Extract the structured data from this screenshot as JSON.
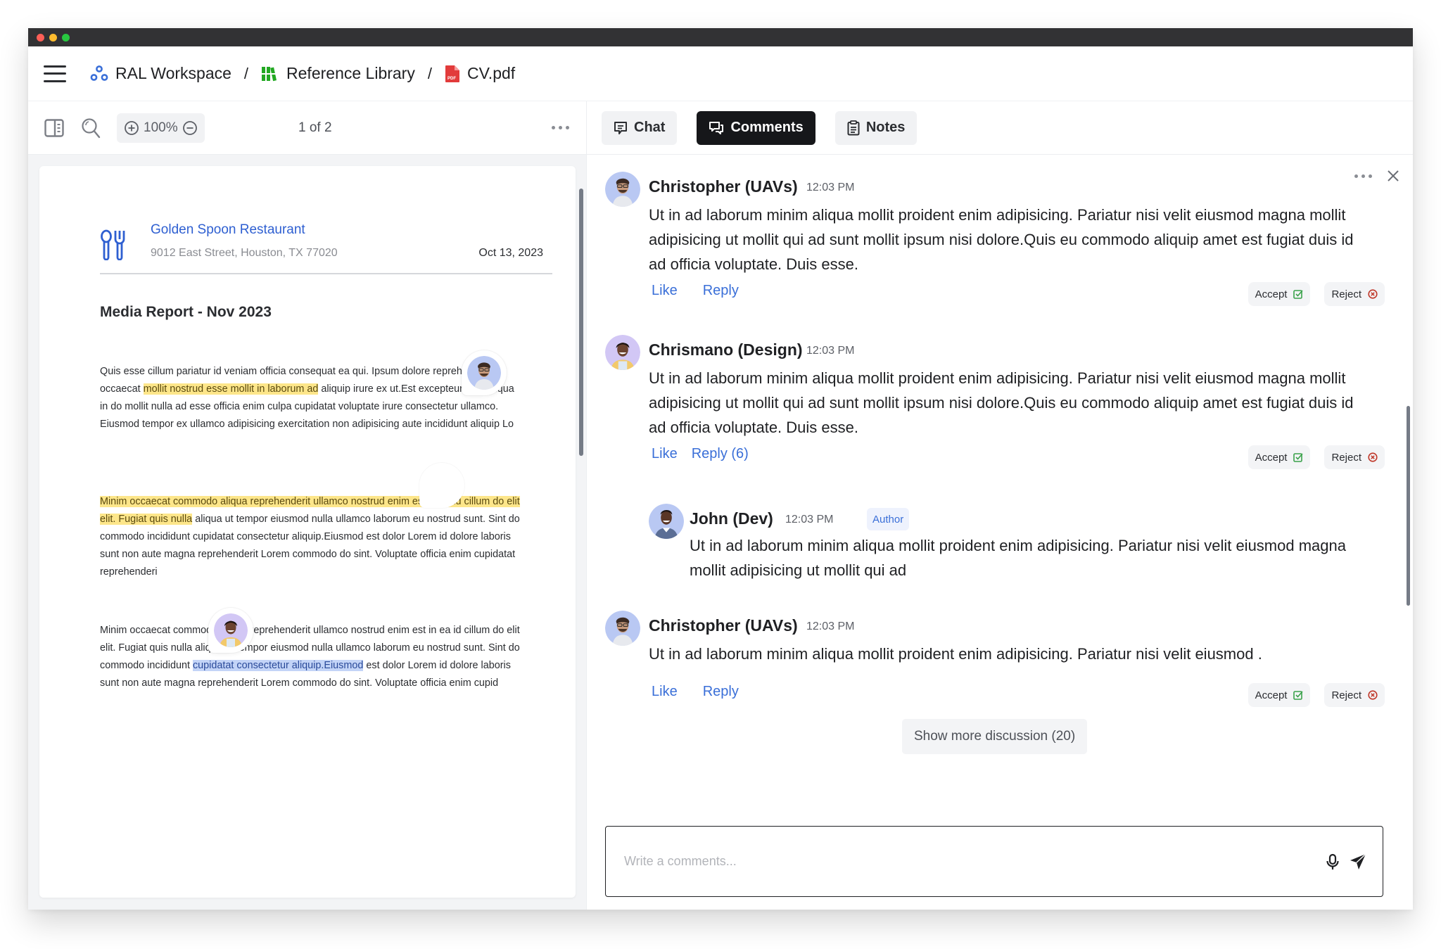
{
  "window": {
    "controls": [
      "close",
      "minimize",
      "zoom"
    ]
  },
  "breadcrumb": {
    "items": [
      {
        "label": "RAL Workspace",
        "icon": "workspace-icon"
      },
      {
        "label": "Reference Library",
        "icon": "library-icon"
      },
      {
        "label": "CV.pdf",
        "icon": "pdf-file-icon"
      }
    ],
    "separator": "/"
  },
  "viewer_toolbar": {
    "zoom_level": "100%",
    "page_indicator": "1 of 2"
  },
  "document": {
    "company": "Golden Spoon Restaurant",
    "address": "9012 East Street, Houston, TX 77020",
    "date": "Oct 13, 2023",
    "title": "Media Report - Nov 2023",
    "paragraph1": {
      "before": "Quis esse cillum pariatur id veniam officia consequat ea qui. Ipsum dolore reprehenderit occaecat ",
      "highlight": "mollit nostrud esse mollit in laborum ad",
      "after": " aliquip irure ex ut.Est excepteur duis aliqua in do mollit nulla ad esse officia enim culpa cupidatat voluptate irure consectetur ullamco. Eiusmod tempor ex ullamco adipisicing exercitation non adipisicing aute incididunt aliquip Lo"
    },
    "paragraph2": {
      "highlight": "Minim occaecat commodo aliqua reprehenderit ullamco nostrud enim est in ea id cillum do elit elit. Fugiat quis nulla",
      "after": " aliqua ut tempor eiusmod nulla ullamco laborum eu nostrud sunt. Sint do commodo incididunt cupidatat consectetur aliquip.Eiusmod est dolor Lorem id dolore laboris sunt non aute magna reprehenderit Lorem commodo do sint. Voluptate officia enim cupidatat reprehenderi"
    },
    "paragraph3": {
      "before": "Minim occaecat commodo aliqua reprehenderit ullamco nostrud enim est in ea id cillum do elit elit. Fugiat quis nulla aliqua ut tempor eiusmod nulla ullamco laborum eu nostrud sunt. Sint do commodo incididunt ",
      "highlight": "cupidatat consectetur aliquip.Eiusmod",
      "after": " est dolor Lorem id dolore laboris sunt non aute magna reprehenderit Lorem commodo do sint. Voluptate officia enim cupid"
    }
  },
  "tabs": [
    {
      "label": "Chat",
      "icon": "chat-icon",
      "active": false
    },
    {
      "label": "Comments",
      "icon": "comments-icon",
      "active": true
    },
    {
      "label": "Notes",
      "icon": "notes-icon",
      "active": false
    }
  ],
  "comments": [
    {
      "author": "Christopher (UAVs)",
      "time": "12:03 PM",
      "body": "Ut in ad laborum minim aliqua mollit proident enim adipisicing. Pariatur nisi velit eiusmod magna mollit adipisicing ut mollit qui ad sunt mollit ipsum nisi dolore.Quis eu commodo aliquip amet est fugiat duis id ad officia voluptate. Duis esse.",
      "like_label": "Like",
      "reply_label": "Reply",
      "accept_label": "Accept",
      "reject_label": "Reject"
    },
    {
      "author": "Chrismano (Design)",
      "time": "12:03 PM",
      "body": "Ut in ad laborum minim aliqua mollit proident enim adipisicing. Pariatur nisi velit eiusmod magna mollit adipisicing ut mollit qui ad sunt mollit ipsum nisi dolore.Quis eu commodo aliquip amet est fugiat duis id ad officia voluptate. Duis esse.",
      "like_label": "Like",
      "reply_label": "Reply (6)",
      "accept_label": "Accept",
      "reject_label": "Reject",
      "replies": [
        {
          "author": "John (Dev)",
          "time": "12:03 PM",
          "badge": "Author",
          "body": "Ut in ad laborum minim aliqua mollit proident enim adipisicing. Pariatur nisi velit eiusmod magna mollit adipisicing ut mollit qui ad"
        }
      ]
    },
    {
      "author": "Christopher (UAVs)",
      "time": "12:03 PM",
      "body": "Ut in ad laborum minim aliqua mollit proident enim adipisicing. Pariatur nisi velit eiusmod .",
      "like_label": "Like",
      "reply_label": "Reply",
      "accept_label": "Accept",
      "reject_label": "Reject"
    }
  ],
  "show_more_label": "Show more discussion (20)",
  "composer": {
    "placeholder": "Write a comments...",
    "value": ""
  },
  "colors": {
    "accent_blue": "#3a6fd8",
    "highlight_yellow": "#fde68a",
    "highlight_blue": "#c3d4f7",
    "active_tab": "#16171a",
    "accept_green": "#3aa14a",
    "reject_red": "#c0392b",
    "pdf_red": "#e23b3b",
    "library_green": "#22a822"
  }
}
